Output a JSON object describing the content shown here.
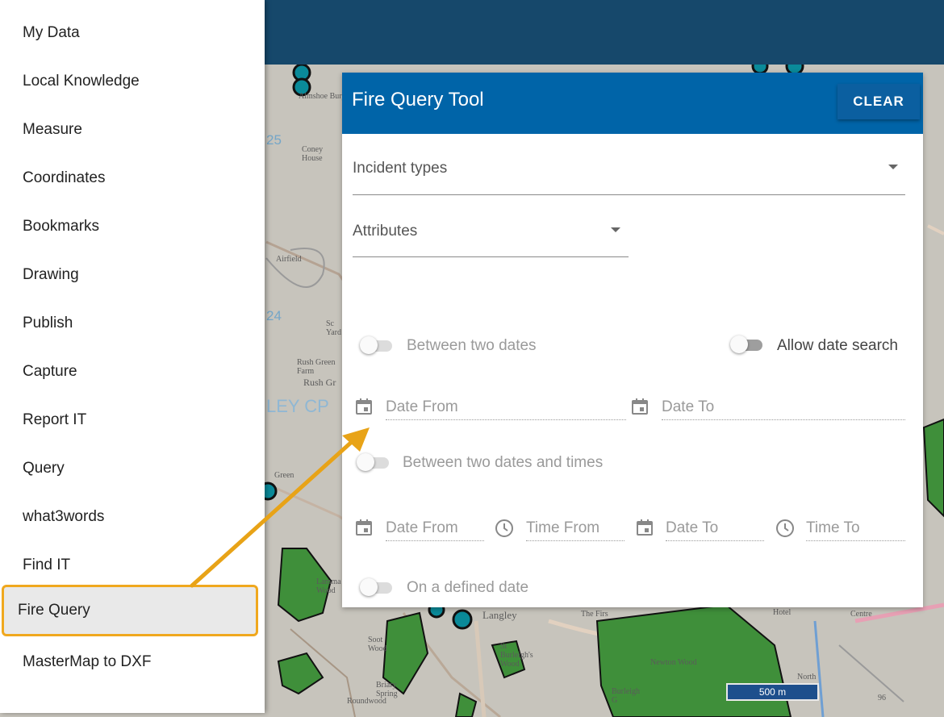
{
  "sidebar": {
    "items": [
      {
        "label": "My Data"
      },
      {
        "label": "Local Knowledge"
      },
      {
        "label": "Measure"
      },
      {
        "label": "Coordinates"
      },
      {
        "label": "Bookmarks"
      },
      {
        "label": "Drawing"
      },
      {
        "label": "Publish"
      },
      {
        "label": "Capture"
      },
      {
        "label": "Report IT"
      },
      {
        "label": "Query"
      },
      {
        "label": "what3words"
      },
      {
        "label": "Find IT"
      },
      {
        "label": "Fire Query"
      },
      {
        "label": "MasterMap to DXF"
      }
    ],
    "active": "Fire Query"
  },
  "panel": {
    "title": "Fire Query Tool",
    "clear_label": "CLEAR",
    "incident_types_label": "Incident types",
    "attributes_label": "Attributes",
    "between_two_dates_label": "Between two dates",
    "allow_date_search_label": "Allow date search",
    "date_from_placeholder": "Date From",
    "date_to_placeholder": "Date To",
    "between_dates_times_label": "Between two dates and times",
    "date_from_placeholder_2": "Date From",
    "time_from_placeholder": "Time From",
    "date_to_placeholder_2": "Date To",
    "time_to_placeholder": "Time To",
    "defined_date_label": "On a defined date"
  },
  "map": {
    "labels": {
      "almshoe": "Almshoe Bury",
      "coney": "Coney House",
      "airfield": "Airfield",
      "rushgreen": "Rush Green Farm",
      "rushgr": "Rush Gr",
      "green": "Green",
      "langley": "Langley",
      "lammas": "Lamma Wood",
      "firs": "The Firs",
      "newton": "Newton Wood",
      "hotel": "Hotel",
      "centre": "Centre",
      "north": "North",
      "briary": "Briary Spring",
      "roundwood": "Roundwood",
      "soot": "Soot Wood",
      "burleigh": "Burleigh G",
      "stlarleigh": "St Burleigh's Wood",
      "sc": "Sc Yard",
      "lc": "LEY CP",
      "n96": "96"
    },
    "grid": {
      "n25": "25",
      "n24": "24"
    },
    "scale_label": "500 m"
  },
  "colors": {
    "header": "#16486b",
    "panel_header": "#0064a8",
    "highlight": "#f0a81e",
    "woodland": "#3f8f3a"
  }
}
